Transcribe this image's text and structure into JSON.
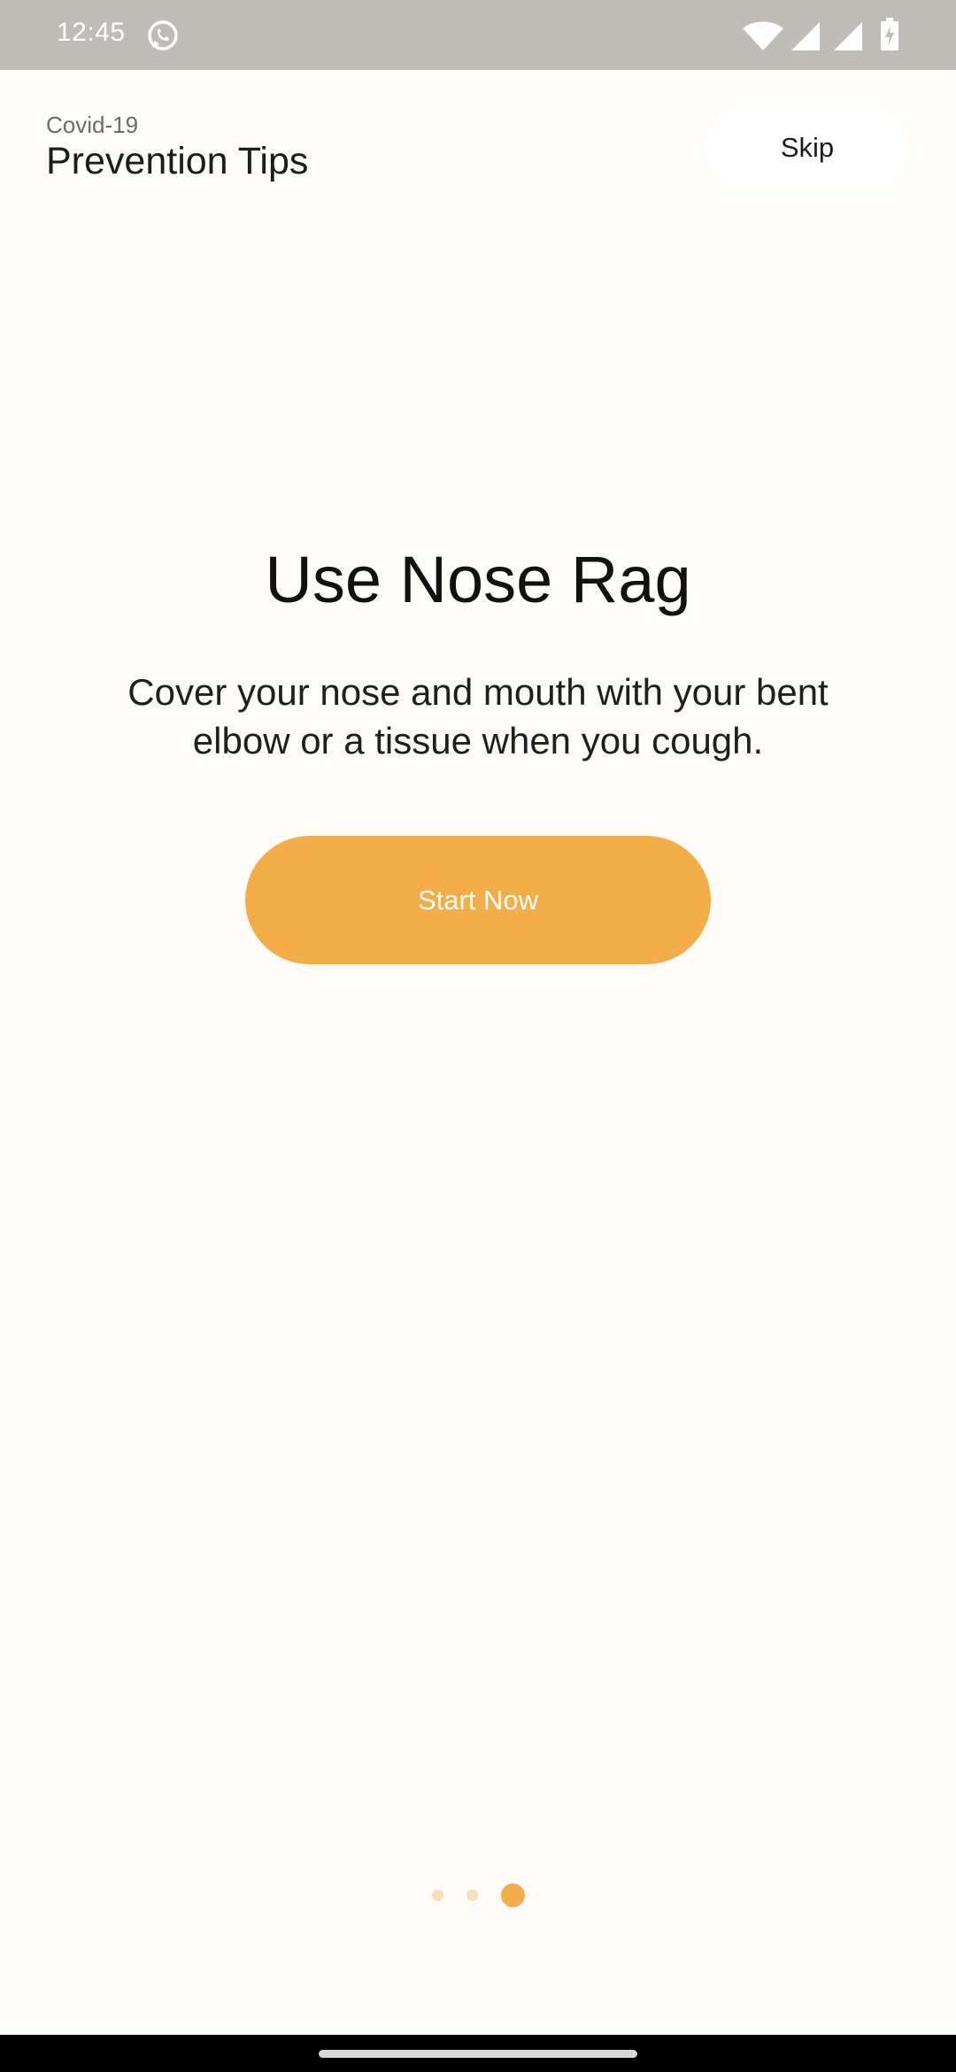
{
  "status_bar": {
    "time": "12:45",
    "app_icon": "whatsapp-icon",
    "icons": [
      "wifi-icon",
      "signal-icon",
      "signal-icon",
      "battery-icon"
    ]
  },
  "header": {
    "subtitle": "Covid-19",
    "title": "Prevention Tips",
    "skip_label": "Skip"
  },
  "tip": {
    "title": "Use Nose Rag",
    "body": "Cover your nose and mouth with your bent elbow or a tissue when you cough.",
    "button_label": "Start Now"
  },
  "pagination": {
    "total": 3,
    "active_index": 3
  },
  "colors": {
    "accent": "#f3ae49",
    "accent_light": "#f8dfb9",
    "background": "#fefcf9",
    "status_bar": "#bfbcb8"
  }
}
